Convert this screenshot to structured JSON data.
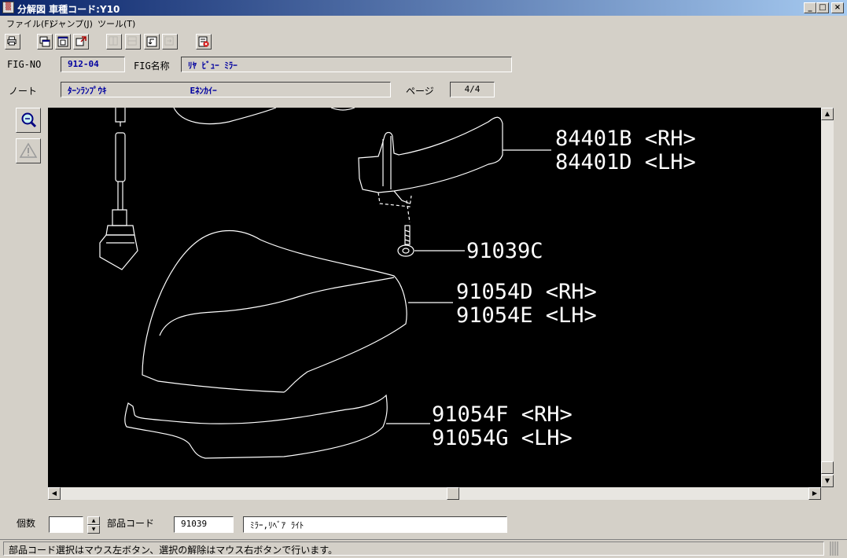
{
  "window": {
    "title": "分解図 車種コード:Y10",
    "icon": "app-icon",
    "controls": {
      "minimize": "_",
      "maximize": "□",
      "close": "×"
    }
  },
  "menu": [
    {
      "label": "ファイル(F)"
    },
    {
      "label": "ジャンプ(J)"
    },
    {
      "label": "ツール(T)"
    }
  ],
  "toolbar": {
    "buttons": [
      {
        "icon": "print-icon",
        "enabled": true
      },
      {
        "icon": "window-1-icon",
        "enabled": true
      },
      {
        "icon": "window-2-icon",
        "enabled": true
      },
      {
        "icon": "window-3-icon",
        "enabled": true
      },
      {
        "icon": "tile-1-icon",
        "enabled": false
      },
      {
        "icon": "tile-2-icon",
        "enabled": false
      },
      {
        "icon": "tile-3-icon",
        "enabled": true
      },
      {
        "icon": "tile-4-icon",
        "enabled": false
      },
      {
        "icon": "exit-icon",
        "enabled": true
      }
    ]
  },
  "header": {
    "fig_no_label": "FIG-NO",
    "fig_no": "912-04",
    "fig_name_label": "FIG名称",
    "fig_name": "ﾘﾔ ﾋﾞｭｰ ﾐﾗｰ",
    "note_label": "ノート",
    "note": "ﾀｰﾝﾗﾝﾌﾟｳｷ                Eﾈﾝｶｲｰ",
    "page_label": "ページ",
    "page": "4/4"
  },
  "side_tools": [
    {
      "icon": "zoom-icon",
      "enabled": true
    },
    {
      "icon": "warning-icon",
      "enabled": false
    }
  ],
  "diagram": {
    "callouts": [
      {
        "lines": [
          "84401B <RH>",
          "84401D <LH>"
        ]
      },
      {
        "lines": [
          "91039C"
        ]
      },
      {
        "lines": [
          "91054D <RH>",
          "91054E <LH>"
        ]
      },
      {
        "lines": [
          "91054F <RH>",
          "91054G <LH>"
        ]
      }
    ]
  },
  "bottom": {
    "qty_label": "個数",
    "qty_value": "",
    "part_code_label": "部品コード",
    "part_code": "91039",
    "part_name": "ﾐﾗｰ,ﾘﾍﾞｱ ﾗｲﾄ"
  },
  "status": {
    "text": "部品コード選択はマウス左ボタン、選択の解除はマウス右ボタンで行います。"
  }
}
